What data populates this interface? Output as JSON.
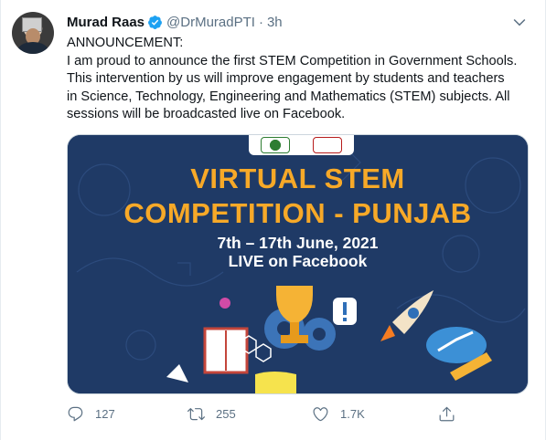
{
  "tweet": {
    "author_name": "Murad Raas",
    "handle": "@DrMuradPTI",
    "separator": "·",
    "time": "3h",
    "text": "ANNOUNCEMENT:\nI am proud to announce the first STEM Competition in Government Schools.\nThis intervention by us will improve engagement by students and teachers\nin Science, Technology, Engineering and Mathematics (STEM) subjects. All\nsessions will be broadcasted live on Facebook."
  },
  "card": {
    "title_line1": "VIRTUAL STEM",
    "title_line2": "COMPETITION  - PUNJAB",
    "dates": "7th – 17th June, 2021",
    "live": "LIVE on Facebook",
    "bg_color": "#1f3a66",
    "title_color": "#f7a928"
  },
  "actions": {
    "reply_count": "127",
    "retweet_count": "255",
    "like_count": "1.7K"
  },
  "icons": {
    "verified": "verified-badge-icon",
    "more": "chevron-down-icon",
    "reply": "reply-icon",
    "retweet": "retweet-icon",
    "like": "heart-icon",
    "share": "share-icon"
  },
  "colors": {
    "verified": "#1da1f2",
    "muted": "#5b7083"
  }
}
